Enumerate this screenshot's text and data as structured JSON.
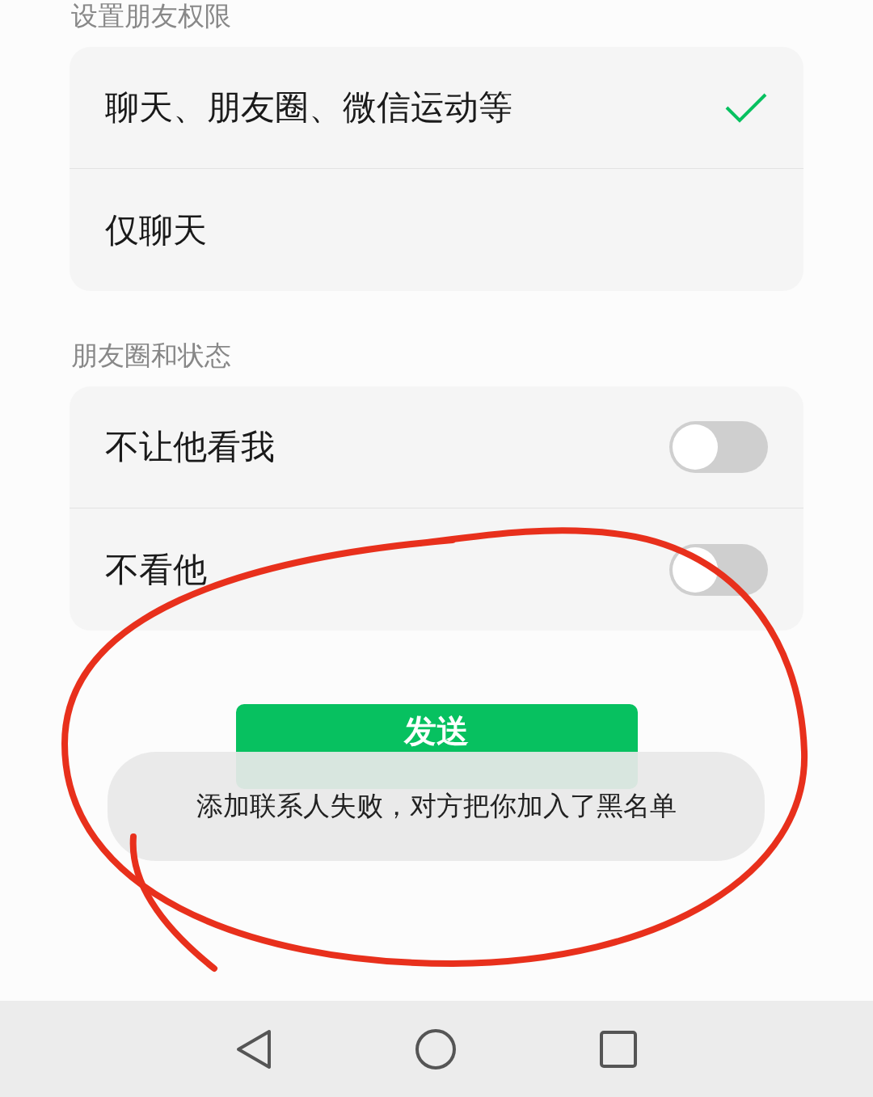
{
  "header_top": "设置朋友权限",
  "permission_options": [
    {
      "label": "聊天、朋友圈、微信运动等",
      "selected": true
    },
    {
      "label": "仅聊天",
      "selected": false
    }
  ],
  "moments_section": {
    "title": "朋友圈和状态",
    "toggles": [
      {
        "label": "不让他看我",
        "on": false
      },
      {
        "label": "不看他",
        "on": false
      }
    ]
  },
  "send_button": "发送",
  "toast": "添加联系人失败，对方把你加入了黑名单"
}
